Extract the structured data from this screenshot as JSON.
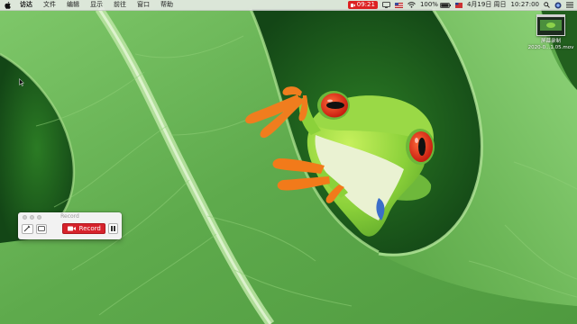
{
  "menubar": {
    "items": [
      "访达",
      "文件",
      "编辑",
      "显示",
      "前往",
      "窗口",
      "帮助"
    ],
    "status": {
      "recording_time": "09:21",
      "battery": "100%",
      "date": "4月19日 周日",
      "time": "10:27:00"
    }
  },
  "desktop": {
    "file_name_line1": "屏幕录制",
    "file_name_line2": "2020-0...1.05.mov"
  },
  "record_widget": {
    "title": "Record",
    "record_label": "Record"
  },
  "colors": {
    "record_red": "#d6222b",
    "leaf_green": "#6cb555",
    "frog_red_eye": "#e8321e"
  },
  "icons": [
    "apple-icon",
    "record-indicator-icon",
    "wifi-icon",
    "flag-icon",
    "battery-icon",
    "search-icon",
    "siri-icon",
    "list-icon",
    "pen-icon",
    "window-select-icon",
    "camera-icon",
    "pause-icon",
    "cursor-icon"
  ]
}
